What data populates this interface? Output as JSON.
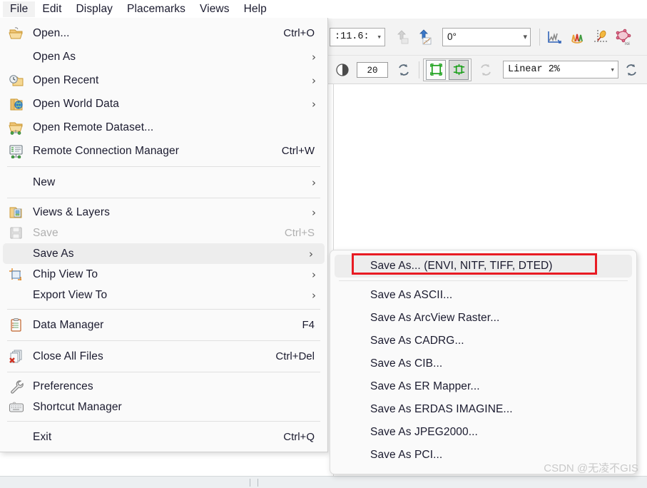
{
  "menubar": {
    "items": [
      {
        "label": "File",
        "active": true
      },
      {
        "label": "Edit",
        "active": false
      },
      {
        "label": "Display",
        "active": false
      },
      {
        "label": "Placemarks",
        "active": false
      },
      {
        "label": "Views",
        "active": false
      },
      {
        "label": "Help",
        "active": false
      }
    ]
  },
  "toolbar_row1": {
    "zoom_value": ":11.6:",
    "rotation_value": "0°",
    "icons": [
      "arrow-up-to-north-disabled-icon",
      "arrow-up-north-rotate-icon",
      "spectral-profile-blue-icon",
      "spectral-profile-color-icon",
      "annotation-pen-icon",
      "roi-tool-icon"
    ]
  },
  "toolbar_row2": {
    "brightness_icon": "contrast-circle-icon",
    "brightness_value": "20",
    "refresh_icon": "refresh-icon",
    "stretch_full_extent_icon": "zoom-to-full-extent-icon",
    "stretch_view_extent_icon": "zoom-to-view-extent-icon",
    "reset_icon": "reset-disabled-icon",
    "stretch_value": "Linear 2%",
    "trailing_refresh_icon": "refresh-icon"
  },
  "file_menu": {
    "items": [
      {
        "id": "open",
        "label": "Open...",
        "accel": "Ctrl+O",
        "icon": "open-folder-icon",
        "arrow": false,
        "disabled": false,
        "selected": false
      },
      {
        "id": "open-as",
        "label": "Open As",
        "accel": "",
        "icon": "",
        "arrow": true,
        "disabled": false,
        "selected": false
      },
      {
        "id": "open-recent",
        "label": "Open Recent",
        "accel": "",
        "icon": "recent-folder-clock-icon",
        "arrow": true,
        "disabled": false,
        "selected": false
      },
      {
        "id": "open-world-data",
        "label": "Open World Data",
        "accel": "",
        "icon": "folder-globe-icon",
        "arrow": true,
        "disabled": false,
        "selected": false
      },
      {
        "id": "open-remote-dataset",
        "label": "Open Remote Dataset...",
        "accel": "",
        "icon": "folder-network-icon",
        "arrow": false,
        "disabled": false,
        "selected": false
      },
      {
        "id": "remote-connection-manager",
        "label": "Remote Connection Manager",
        "accel": "Ctrl+W",
        "icon": "monitor-network-icon",
        "arrow": false,
        "disabled": false,
        "selected": false
      },
      {
        "id": "sep1",
        "separator": true
      },
      {
        "id": "new",
        "label": "New",
        "accel": "",
        "icon": "",
        "arrow": true,
        "disabled": false,
        "selected": false
      },
      {
        "id": "sep2",
        "separator": true
      },
      {
        "id": "views-and-layers",
        "label": "Views & Layers",
        "accel": "",
        "icon": "views-layers-icon",
        "arrow": true,
        "disabled": false,
        "selected": false
      },
      {
        "id": "save",
        "label": "Save",
        "accel": "Ctrl+S",
        "icon": "floppy-save-icon",
        "arrow": false,
        "disabled": true,
        "selected": false
      },
      {
        "id": "save-as",
        "label": "Save As",
        "accel": "",
        "icon": "",
        "arrow": true,
        "disabled": false,
        "selected": true
      },
      {
        "id": "chip-view-to",
        "label": "Chip View To",
        "accel": "",
        "icon": "chip-view-icon",
        "arrow": true,
        "disabled": false,
        "selected": false
      },
      {
        "id": "export-view-to",
        "label": "Export View To",
        "accel": "",
        "icon": "",
        "arrow": true,
        "disabled": false,
        "selected": false
      },
      {
        "id": "sep3",
        "separator": true
      },
      {
        "id": "data-manager",
        "label": "Data Manager",
        "accel": "F4",
        "icon": "clipboard-icon",
        "arrow": false,
        "disabled": false,
        "selected": false
      },
      {
        "id": "sep4",
        "separator": true
      },
      {
        "id": "close-all-files",
        "label": "Close All Files",
        "accel": "Ctrl+Del",
        "icon": "close-all-files-icon",
        "arrow": false,
        "disabled": false,
        "selected": false
      },
      {
        "id": "sep5",
        "separator": true
      },
      {
        "id": "preferences",
        "label": "Preferences",
        "accel": "",
        "icon": "wrench-icon",
        "arrow": false,
        "disabled": false,
        "selected": false
      },
      {
        "id": "shortcut-manager",
        "label": "Shortcut Manager",
        "accel": "",
        "icon": "keyboard-icon",
        "arrow": false,
        "disabled": false,
        "selected": false
      },
      {
        "id": "sep6",
        "separator": true
      },
      {
        "id": "exit",
        "label": "Exit",
        "accel": "Ctrl+Q",
        "icon": "",
        "arrow": false,
        "disabled": false,
        "selected": false
      }
    ]
  },
  "save_as_submenu": {
    "items": [
      {
        "id": "save-as-envi",
        "label": "Save As... (ENVI, NITF, TIFF, DTED)",
        "highlighted": true
      },
      {
        "id": "sep-a",
        "separator": true
      },
      {
        "id": "save-as-ascii",
        "label": "Save As ASCII...",
        "highlighted": false
      },
      {
        "id": "save-as-arcview",
        "label": "Save As ArcView Raster...",
        "highlighted": false
      },
      {
        "id": "save-as-cadrg",
        "label": "Save As CADRG...",
        "highlighted": false
      },
      {
        "id": "save-as-cib",
        "label": "Save As CIB...",
        "highlighted": false
      },
      {
        "id": "save-as-ermapper",
        "label": "Save As ER Mapper...",
        "highlighted": false
      },
      {
        "id": "save-as-erdas",
        "label": "Save As ERDAS IMAGINE...",
        "highlighted": false
      },
      {
        "id": "save-as-jpeg2000",
        "label": "Save As JPEG2000...",
        "highlighted": false
      },
      {
        "id": "save-as-pci",
        "label": "Save As PCI...",
        "highlighted": false
      }
    ],
    "highlight_box_color": "#e81b23"
  },
  "watermark": {
    "text": "CSDN @无凌不GIS"
  }
}
